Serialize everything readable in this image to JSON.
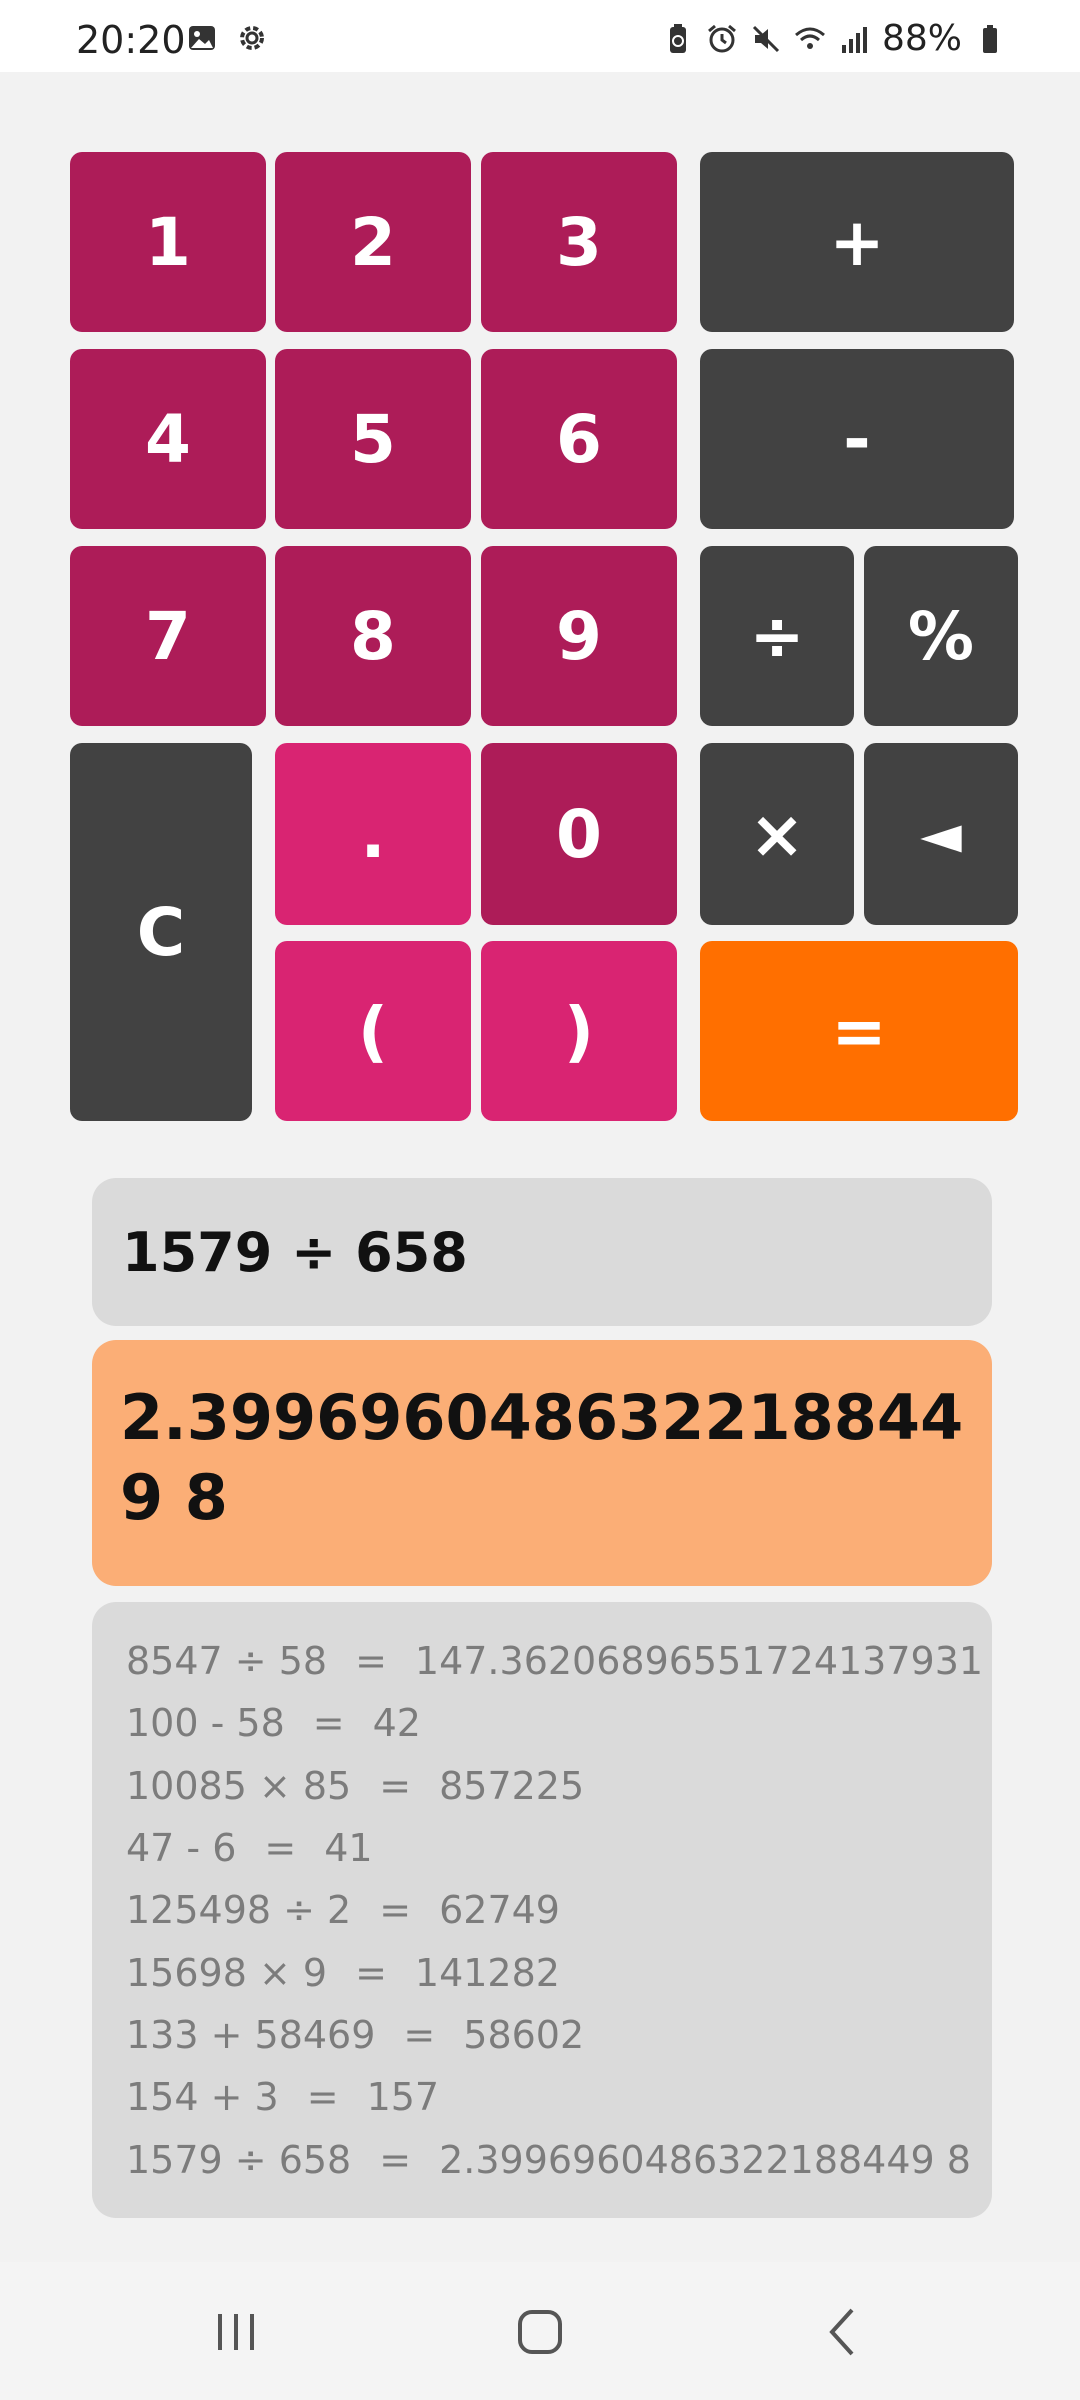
{
  "status_bar": {
    "time": "20:20",
    "battery": "88%",
    "left_icons": [
      "image-icon",
      "gear-icon"
    ],
    "right_icons": [
      "recycle-battery-icon",
      "alarm-icon",
      "mute-icon",
      "wifi-icon",
      "signal-icon",
      "battery-icon"
    ]
  },
  "keypad": {
    "k1": "1",
    "k2": "2",
    "k3": "3",
    "k4": "4",
    "k5": "5",
    "k6": "6",
    "k7": "7",
    "k8": "8",
    "k9": "9",
    "k0": "0",
    "dot": ".",
    "open_paren": "(",
    "close_paren": ")",
    "clear": "C",
    "plus": "+",
    "minus": "-",
    "divide": "÷",
    "percent": "%",
    "multiply": "×",
    "backspace": "◄",
    "equals": "="
  },
  "expression": "1579 ÷ 658",
  "result": "2.3996960486322188449 8",
  "history": [
    {
      "expr": "8547 ÷ 58",
      "eq": "=",
      "result": "147.36206896551724137931"
    },
    {
      "expr": "100 - 58",
      "eq": "=",
      "result": "42"
    },
    {
      "expr": "10085 × 85",
      "eq": "=",
      "result": "857225"
    },
    {
      "expr": "47 - 6",
      "eq": "=",
      "result": "41"
    },
    {
      "expr": "125498 ÷ 2",
      "eq": "=",
      "result": "62749"
    },
    {
      "expr": "15698 × 9",
      "eq": "=",
      "result": "141282"
    },
    {
      "expr": "133 + 58469",
      "eq": "=",
      "result": "58602"
    },
    {
      "expr": "154 + 3",
      "eq": "=",
      "result": "157"
    },
    {
      "expr": "1579 ÷ 658",
      "eq": "=",
      "result": "2.3996960486322188449 8"
    }
  ],
  "colors": {
    "digit_key": "#ad1c58",
    "light_key": "#d92472",
    "operator_key": "#424242",
    "equals_key": "#ff6f00",
    "result_background": "#fbae76"
  },
  "nav_bar": {
    "icons": [
      "recent-apps-icon",
      "home-icon",
      "back-icon"
    ]
  }
}
